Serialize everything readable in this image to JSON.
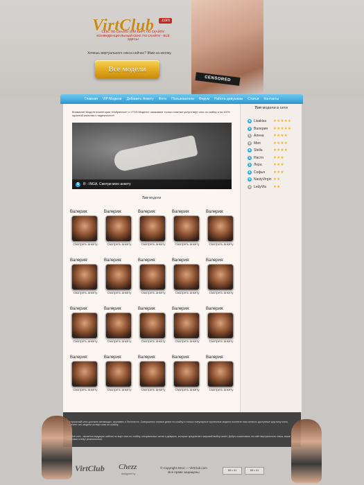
{
  "header": {
    "logo_text": "VirtClub",
    "logo_com": ".com",
    "tagline": "СЕКС ПО СКАЙПУ ИЛИ ВИРТ ПО СКАЙПУ. КОНФИДЕНЦИАЛЬНЫЙ СЕКС ПО СКАЙПУ - ВСЁ ЗДЕСЬ!",
    "promo_text": "Хочешь виртуального секса сейчас? Жми на кнопку.",
    "models_button": "Все модели",
    "censored_label": "CENSORED"
  },
  "nav": {
    "items": [
      "Главная",
      "VIP Модели",
      "Добавить Анкету",
      "Фото",
      "Пользователи",
      "Форум",
      "Работа девушкам",
      "Статьи",
      "Контакты"
    ]
  },
  "main": {
    "intro": "Внимание! Модели в категории «Избранные» и «ТОП-Модели» оказывают только платные услуги вирт секс по скайпу и на 100% гарантий качества и надежности!!!",
    "feature_caption": "R - INGA. Смотри мою анкету",
    "top_models_title_bold": "Топ",
    "top_models_title_rest": " модели",
    "card_name": "Валерия:",
    "card_link": "Смотреть анкету",
    "card_count": 20
  },
  "sidebar": {
    "title_bold": "Топ",
    "title_rest": " модели в сети",
    "models": [
      {
        "name": "Lisakisa",
        "stars": "★★★★★",
        "online": true
      },
      {
        "name": "Валерия",
        "stars": "★★★★★",
        "online": true
      },
      {
        "name": "Алена",
        "stars": "★★★★",
        "online": false
      },
      {
        "name": "Мия",
        "stars": "★★★★",
        "online": false
      },
      {
        "name": "Stella",
        "stars": "★★★★",
        "online": true
      },
      {
        "name": "Настя",
        "stars": "★★★",
        "online": true
      },
      {
        "name": "Лера",
        "stars": "★★★",
        "online": true
      },
      {
        "name": "Софья",
        "stars": "★★★",
        "online": true
      },
      {
        "name": "NastyVirgin",
        "stars": "★★",
        "online": true
      },
      {
        "name": "LedyVla",
        "stars": "★★",
        "online": false
      }
    ]
  },
  "footer": {
    "band_text_1": "Виртуальный секс для всех желающих, анонимно и бесплатно. Совершенно первое девят по скайпу и только популярные эротичные модели посетите наш каталог, доступные круглосуточно. Посетите чат, модели из вирт секс по скайпу.",
    "band_text_2": "VirtClub.com - является ведущим сайтом по вирт секс по скайпу, специальных чатов и девушек, которые предлагают широкий выбор анкет. Добро пожаловать на сайт виртуального секса, ваши фантазии станут реальностью.",
    "logo": "VirtClub",
    "designer": "Chezz",
    "designer_sub": "designed by",
    "copyright": "© Copyright 2014 — VirtClub.com",
    "rights": "Все права защищены",
    "counter_1": "88 х 31",
    "counter_2": "88 х 31"
  }
}
